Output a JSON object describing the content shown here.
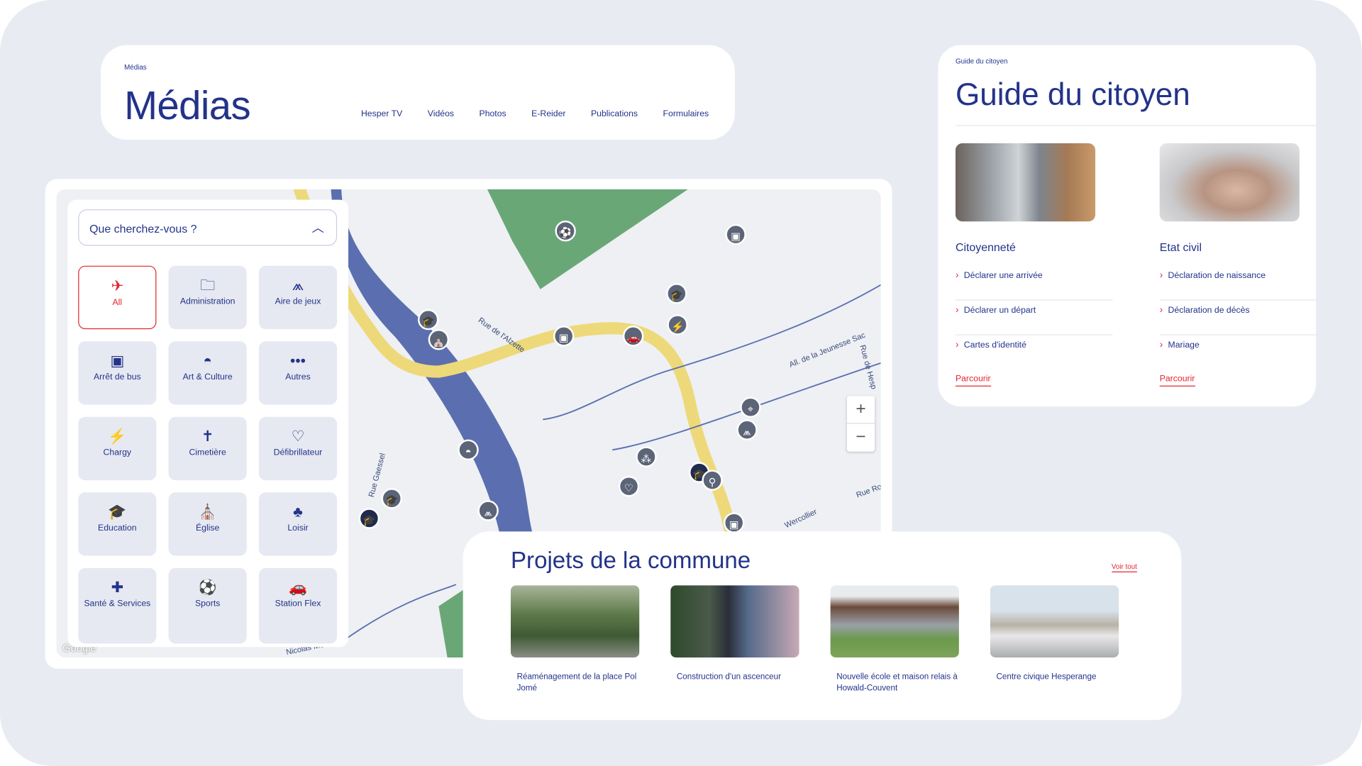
{
  "medias": {
    "breadcrumb": "Médias",
    "title": "Médias",
    "nav": [
      "Hesper TV",
      "Vidéos",
      "Photos",
      "E-Reider",
      "Publications",
      "Formulaires"
    ]
  },
  "guide": {
    "breadcrumb": "Guide du citoyen",
    "title": "Guide du citoyen",
    "columns": [
      {
        "title": "Citoyenneté",
        "links": [
          "Déclarer une arrivée",
          "Déclarer un départ",
          "Cartes d'identité"
        ],
        "more": "Parcourir"
      },
      {
        "title": "Etat civil",
        "links": [
          "Déclaration de naissance",
          "Déclaration de décès",
          "Mariage"
        ],
        "more": "Parcourir"
      }
    ]
  },
  "map": {
    "search_placeholder": "Que cherchez-vous ?",
    "attribution": "Google",
    "categories": [
      {
        "label": "All",
        "icon": "all-icon",
        "glyph": "✈",
        "active": true
      },
      {
        "label": "Administration",
        "icon": "folder-icon",
        "glyph": "🗀"
      },
      {
        "label": "Aire de jeux",
        "icon": "slide-icon",
        "glyph": "⩕"
      },
      {
        "label": "Arrêt de bus",
        "icon": "bus-icon",
        "glyph": "▣"
      },
      {
        "label": "Art & Culture",
        "icon": "masks-icon",
        "glyph": "◓"
      },
      {
        "label": "Autres",
        "icon": "dots-icon",
        "glyph": "•••"
      },
      {
        "label": "Chargy",
        "icon": "charger-icon",
        "glyph": "⚡"
      },
      {
        "label": "Cimetière",
        "icon": "grave-icon",
        "glyph": "✝"
      },
      {
        "label": "Défibrillateur",
        "icon": "heart-pulse-icon",
        "glyph": "♡"
      },
      {
        "label": "Education",
        "icon": "graduation-cap-icon",
        "glyph": "🎓"
      },
      {
        "label": "Église",
        "icon": "church-icon",
        "glyph": "⛪"
      },
      {
        "label": "Loisir",
        "icon": "tree-icon",
        "glyph": "♣"
      },
      {
        "label": "Santé & Services",
        "icon": "medical-bag-icon",
        "glyph": "✚"
      },
      {
        "label": "Sports",
        "icon": "ball-icon",
        "glyph": "⚽"
      },
      {
        "label": "Station Flex",
        "icon": "car-icon",
        "glyph": "🚗"
      }
    ],
    "street_labels": [
      "Rue de l'Alzette",
      "All. de la Jeunesse Sac",
      "Rue de Hesp",
      "Rue Gaessel",
      "Wercollier",
      "Rue Ro",
      "Nicolas Mer"
    ],
    "zoom_in": "+",
    "zoom_out": "−"
  },
  "projects": {
    "title": "Projets de la commune",
    "see_all": "Voir tout",
    "items": [
      "Réaménagement de la place Pol Jomé",
      "Construction d'un ascenceur",
      "Nouvelle école et maison relais à Howald-Couvent",
      "Centre civique Hesperange"
    ]
  },
  "colors": {
    "primary": "#23338a",
    "accent": "#e3262e",
    "background": "#e8ebf2"
  }
}
